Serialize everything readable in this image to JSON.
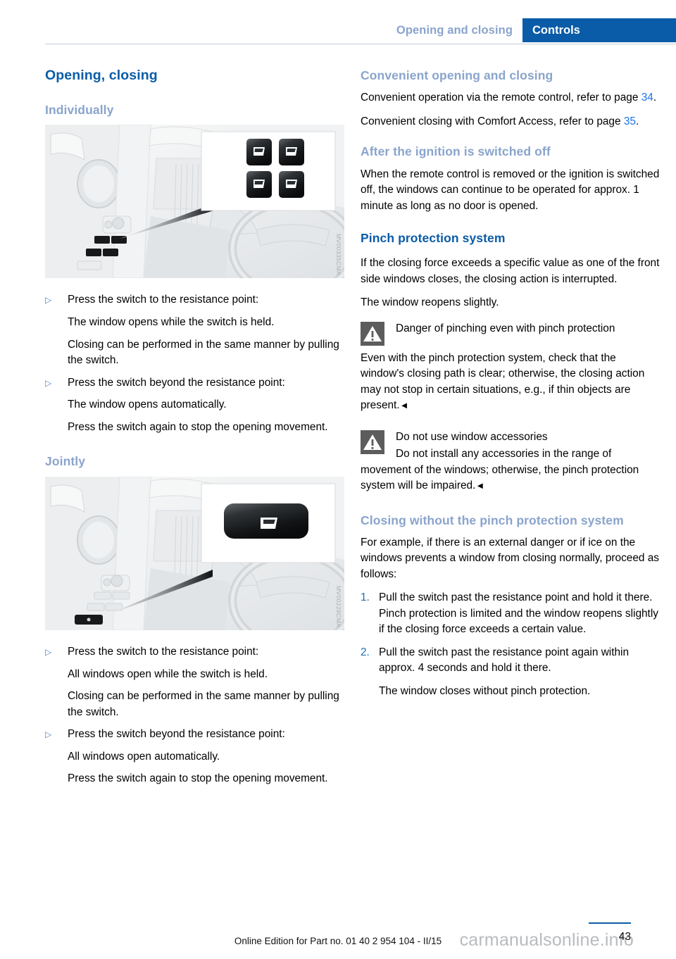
{
  "header": {
    "breadcrumb": "Opening and closing",
    "section_tab": "Controls",
    "accent_blue": "#0a5ca8",
    "muted_blue": "#8aa4cc"
  },
  "left_column": {
    "title": "Opening, closing",
    "individually": {
      "heading": "Individually",
      "figure_code": "MV00335CMA",
      "figure_alt": "Driver door panel with four individual window switches",
      "steps": [
        {
          "marker": "▷",
          "text": "Press the switch to the resistance point:",
          "continuations": [
            "The window opens while the switch is held.",
            "Closing can be performed in the same manner by pulling the switch."
          ]
        },
        {
          "marker": "▷",
          "text": "Press the switch beyond the resistance point:",
          "continuations": [
            "The window opens automatically.",
            "Press the switch again to stop the opening movement."
          ]
        }
      ]
    },
    "jointly": {
      "heading": "Jointly",
      "figure_code": "MV00228CMA",
      "figure_alt": "Driver door panel with single joint window switch",
      "steps": [
        {
          "marker": "▷",
          "text": "Press the switch to the resistance point:",
          "continuations": [
            "All windows open while the switch is held.",
            "Closing can be performed in the same manner by pulling the switch."
          ]
        },
        {
          "marker": "▷",
          "text": "Press the switch beyond the resistance point:",
          "continuations": [
            "All windows open automatically.",
            "Press the switch again to stop the opening movement."
          ]
        }
      ]
    }
  },
  "right_column": {
    "convenient": {
      "heading": "Convenient opening and closing",
      "para1_before": "Convenient operation via the remote control, refer to page ",
      "para1_ref": "34",
      "para1_after": ".",
      "para2_before": "Convenient closing with Comfort Access, refer to page ",
      "para2_ref": "35",
      "para2_after": "."
    },
    "after_ignition": {
      "heading": "After the ignition is switched off",
      "para": "When the remote control is removed or the ignition is switched off, the windows can continue to be operated for approx. 1 minute as long as no door is opened."
    },
    "pinch": {
      "heading": "Pinch protection system",
      "para1": "If the closing force exceeds a specific value as one of the front side windows closes, the closing action is interrupted.",
      "para2": "The window reopens slightly."
    },
    "warning1": {
      "icon": "warning-triangle-icon",
      "title": "Danger of pinching even with pinch protection",
      "body": "Even with the pinch protection system, check that the window's closing path is clear; otherwise, the closing action may not stop in certain situations, e.g., if thin objects are present.",
      "end_mark": "◄"
    },
    "warning2": {
      "icon": "warning-triangle-icon",
      "title": "Do not use window accessories",
      "body": "Do not install any accessories in the range of movement of the windows; otherwise, the pinch protection system will be impaired.",
      "end_mark": "◄"
    },
    "closing_without": {
      "heading": "Closing without the pinch protection system",
      "intro": "For example, if there is an external danger or if ice on the windows prevents a window from closing normally, proceed as follows:",
      "steps": [
        {
          "number": "1.",
          "text": "Pull the switch past the resistance point and hold it there. Pinch protection is limited and the window reopens slightly if the closing force exceeds a certain value.",
          "continuations": []
        },
        {
          "number": "2.",
          "text": "Pull the switch past the resistance point again within approx. 4 seconds and hold it there.",
          "continuations": [
            "The window closes without pinch protection."
          ]
        }
      ]
    }
  },
  "footer": {
    "edition_text": "Online Edition for Part no. 01 40 2 954 104 - II/15",
    "watermark": "carmanualsonline.info",
    "page_number": "43"
  }
}
